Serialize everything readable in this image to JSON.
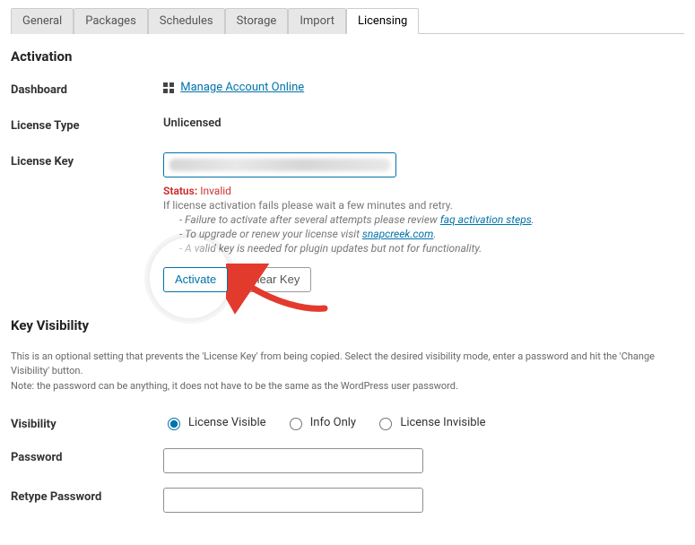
{
  "tabs": {
    "general": "General",
    "packages": "Packages",
    "schedules": "Schedules",
    "storage": "Storage",
    "import": "Import",
    "licensing": "Licensing"
  },
  "sections": {
    "activation_heading": "Activation",
    "key_visibility_heading": "Key Visibility"
  },
  "rows": {
    "dashboard_label": "Dashboard",
    "license_type_label": "License Type",
    "license_key_label": "License Key",
    "visibility_label": "Visibility",
    "password_label": "Password",
    "retype_password_label": "Retype Password"
  },
  "dashboard": {
    "link_text": "Manage Account Online"
  },
  "license_type": {
    "value": "Unlicensed"
  },
  "license_key": {
    "status_label": "Status:",
    "status_value": "Invalid",
    "retry_hint": "If license activation fails please wait a few minutes and retry.",
    "bullet1_prefix": "Failure to activate after several attempts please review ",
    "bullet1_link": "faq activation steps",
    "bullet1_suffix": ".",
    "bullet2_prefix": "To upgrade or renew your license visit ",
    "bullet2_link": "snapcreek.com",
    "bullet2_suffix": ".",
    "bullet3_prefix": "A valid",
    "bullet3_rest": " key is needed for plugin updates but not for functionality.",
    "activate_btn": "Activate",
    "clear_btn": "Clear Key"
  },
  "key_visibility": {
    "desc_line1": "This is an optional setting that prevents the 'License Key' from being copied. Select the desired visibility mode, enter a password and hit the 'Change Visibility' button.",
    "desc_line2": "Note: the password can be anything, it does not have to be the same as the WordPress user password."
  },
  "visibility_options": {
    "visible": "License Visible",
    "info_only": "Info Only",
    "invisible": "License Invisible"
  }
}
